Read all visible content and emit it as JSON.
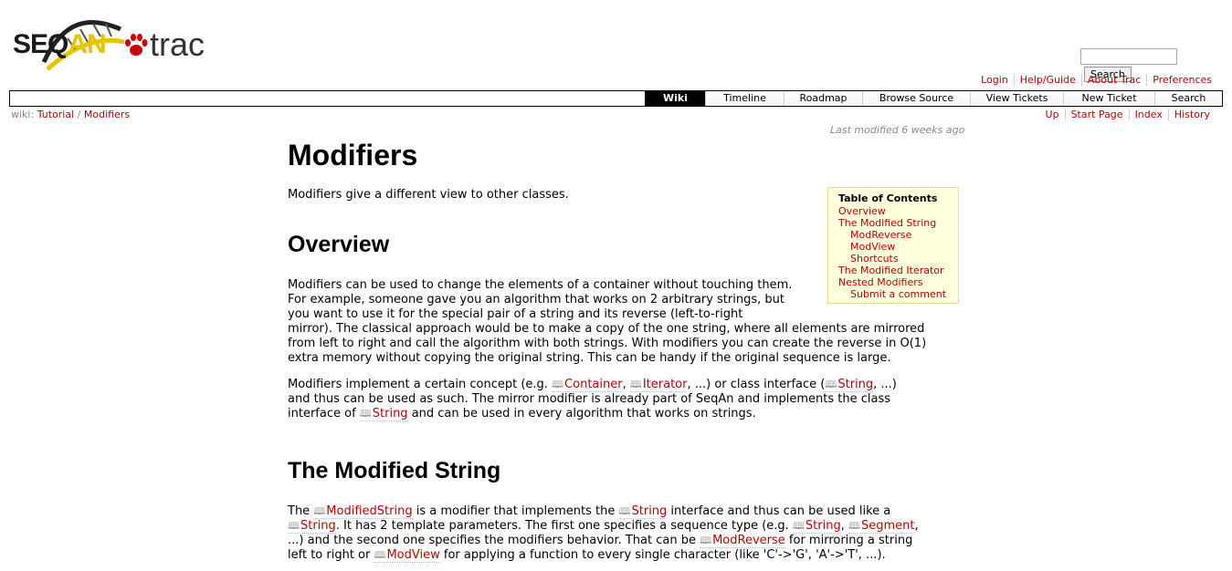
{
  "logo": {
    "seqan": "SEQAN",
    "trac": "trac"
  },
  "search": {
    "placeholder": "",
    "button": "Search"
  },
  "metanav": [
    "Login",
    "Help/Guide",
    "About Trac",
    "Preferences"
  ],
  "mainnav": [
    {
      "label": "Wiki",
      "active": true
    },
    {
      "label": "Timeline"
    },
    {
      "label": "Roadmap"
    },
    {
      "label": "Browse Source"
    },
    {
      "label": "View Tickets"
    },
    {
      "label": "New Ticket"
    },
    {
      "label": "Search"
    }
  ],
  "breadcrumb": {
    "prefix": "wiki:",
    "items": [
      "Tutorial",
      "Modifiers"
    ],
    "sep": "/"
  },
  "ctxnav": [
    "Up",
    "Start Page",
    "Index",
    "History"
  ],
  "last_modified": "Last modified 6 weeks ago",
  "page": {
    "title": "Modifiers",
    "intro": "Modifiers give a different view to other classes.",
    "h_overview": "Overview",
    "p1": "Modifiers can be used to change the elements of a container without touching them.",
    "p1b": "For example, someone gave you an algorithm that works on 2 arbitrary strings, but",
    "p1c": "you want to use it for the special pair of a string and its reverse (left-to-right",
    "p1d": "mirror). The classical approach would be to make a copy of the one string, where all elements are mirrored",
    "p1e": "from left to right and call the algorithm with both strings. With modifiers you can create the reverse in O(1)",
    "p1f": "extra memory without copying the original string. This can be handy if the original sequence is large.",
    "p2_a": "Modifiers implement a certain concept (e.g. ",
    "p2_container": "Container",
    "p2_b": ", ",
    "p2_iterator": "Iterator",
    "p2_c": ", ...) or class interface (",
    "p2_string": "String",
    "p2_d": ", ...)",
    "p2_e": "and thus can be used as such. The mirror modifier is already part of SeqAn and implements the class",
    "p2_f": "interface of ",
    "p2_string2": "String",
    "p2_g": " and can be used in every algorithm that works on strings.",
    "h_modstring": "The Modified String",
    "p3_a": "The ",
    "p3_modstring": "ModifiedString",
    "p3_b": " is a modifier that implements the ",
    "p3_string": "String",
    "p3_c": " interface and thus can be used like a",
    "p3_string2": "String",
    "p3_d": ". It has 2 template parameters. The first one specifies a sequence type (e.g. ",
    "p3_string3": "String",
    "p3_e": ", ",
    "p3_segment": "Segment",
    "p3_f": ",",
    "p3_g": "...) and the second one specifies the modifiers behavior. That can be ",
    "p3_modreverse": "ModReverse",
    "p3_h": " for mirroring a string",
    "p3_i": "left to right or ",
    "p3_modview": "ModView",
    "p3_j": " for applying a function to every single character (like 'C'->'G', 'A'->'T', ...)."
  },
  "toc": {
    "title": "Table of Contents",
    "items": [
      {
        "label": "Overview",
        "level": 1
      },
      {
        "label": "The Modified String",
        "level": 1
      },
      {
        "label": "ModReverse",
        "level": 2
      },
      {
        "label": "ModView",
        "level": 2
      },
      {
        "label": "Shortcuts",
        "level": 2
      },
      {
        "label": "The Modified Iterator",
        "level": 1
      },
      {
        "label": "Nested Modifiers",
        "level": 1
      },
      {
        "label": "Submit a comment",
        "level": 2
      }
    ]
  },
  "colors": {
    "link": "#bb0000",
    "toc_bg": "#ffffdd",
    "logo_yellow": "#e5c400"
  }
}
